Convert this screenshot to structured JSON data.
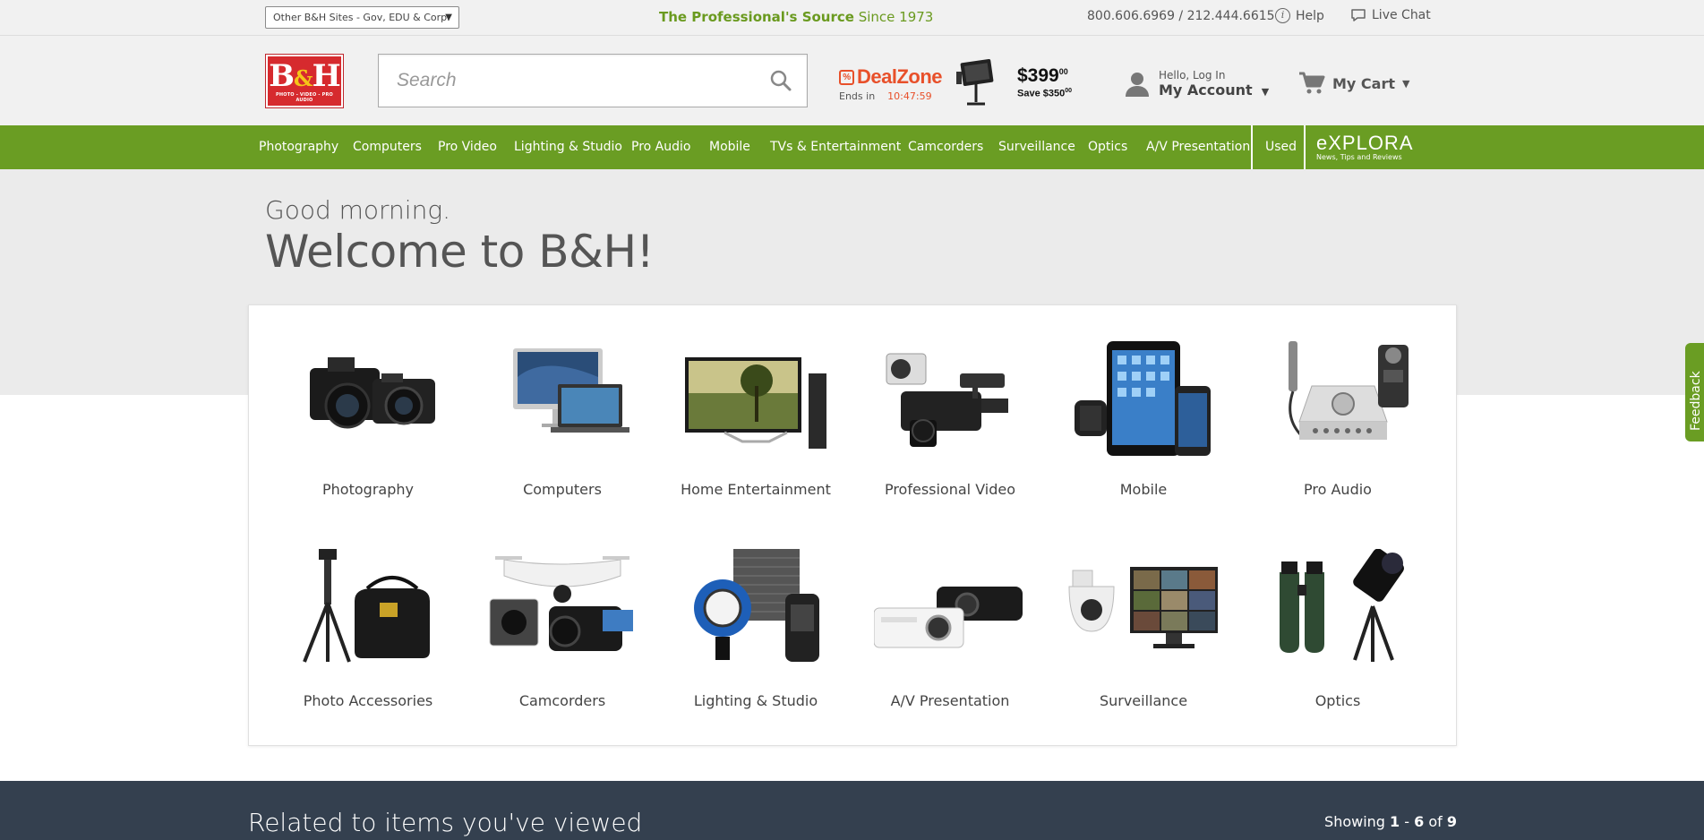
{
  "topbar": {
    "other_sites": "Other B&H Sites - Gov, EDU & Corp.",
    "tagline_bold": "The Professional's Source",
    "tagline_rest": " Since 1973",
    "phone": "800.606.6969 / 212.444.6615",
    "help": "Help",
    "live_chat": "Live Chat"
  },
  "header": {
    "logo_text": "B&H",
    "logo_sub": "PHOTO - VIDEO - PRO AUDIO",
    "search_placeholder": "Search",
    "dealzone": {
      "brand": "DealZone",
      "ends_in": "Ends in",
      "timer": "10:47:59",
      "price": "$399",
      "price_cents": "00",
      "save": "Save $350",
      "save_cents": "00"
    },
    "account": {
      "hello": "Hello, Log In",
      "label": "My Account"
    },
    "cart": "My Cart"
  },
  "nav": {
    "items": [
      "Photography",
      "Computers",
      "Pro Video",
      "Lighting & Studio",
      "Pro Audio",
      "Mobile",
      "TVs & Entertainment",
      "Camcorders",
      "Surveillance",
      "Optics",
      "A/V Presentation"
    ],
    "used": "Used",
    "explora": "eXPLORA",
    "explora_sub": "News, Tips and Reviews"
  },
  "hero": {
    "greeting": "Good morning.",
    "welcome": "Welcome to B&H!"
  },
  "categories": [
    {
      "label": "Photography",
      "icon": "dslr-cameras-icon"
    },
    {
      "label": "Computers",
      "icon": "computers-icon"
    },
    {
      "label": "Home Entertainment",
      "icon": "tv-icon"
    },
    {
      "label": "Professional Video",
      "icon": "pro-video-camera-icon"
    },
    {
      "label": "Mobile",
      "icon": "mobile-devices-icon"
    },
    {
      "label": "Pro Audio",
      "icon": "audio-interface-icon"
    },
    {
      "label": "Photo Accessories",
      "icon": "tripod-bag-icon"
    },
    {
      "label": "Camcorders",
      "icon": "drone-camcorder-icon"
    },
    {
      "label": "Lighting & Studio",
      "icon": "studio-light-icon"
    },
    {
      "label": "A/V Presentation",
      "icon": "projector-icon"
    },
    {
      "label": "Surveillance",
      "icon": "security-camera-icon"
    },
    {
      "label": "Optics",
      "icon": "binoculars-telescope-icon"
    }
  ],
  "related": {
    "title": "Related to items you've viewed",
    "showing_prefix": "Showing ",
    "range_start": "1",
    "range_sep": " - ",
    "range_end": "6",
    "of": " of ",
    "total": "9"
  },
  "feedback": "Feedback",
  "colors": {
    "brand_green": "#6a9d23",
    "brand_red": "#d62a2e",
    "deal_orange": "#e8502a",
    "dark_band": "#34404f"
  }
}
